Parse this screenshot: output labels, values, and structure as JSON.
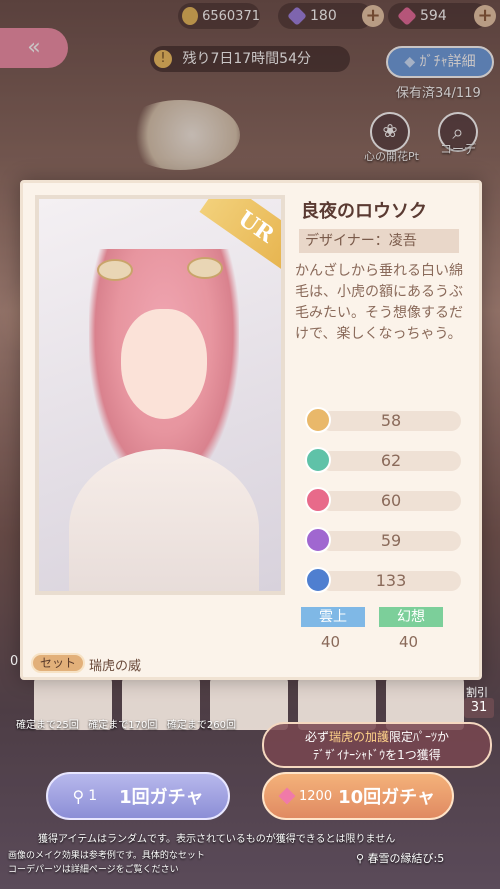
{
  "topbar": {
    "gold": "6560371",
    "purple_gem": "180",
    "pink_gem": "594"
  },
  "timer": "残り7日17時間54分",
  "gacha_detail_button": "ｶﾞﾁｬ詳細",
  "owned": "保有済34/119",
  "side_buttons": {
    "heart_flower": "心の開花Pt",
    "coord": "コーデ"
  },
  "card": {
    "rarity": "UR",
    "title": "良夜のロウソク",
    "designer": "デザイナー：凌吾",
    "description": "かんざしから垂れる白い綿毛は、小虎の額にあるうぶ毛みたい。そう想像するだけで、楽しくなっちゃう。",
    "stats": [
      {
        "value": "58",
        "color": "#e9b86a"
      },
      {
        "value": "62",
        "color": "#5fc2a8"
      },
      {
        "value": "60",
        "color": "#e86a8a"
      },
      {
        "value": "59",
        "color": "#a067d0"
      },
      {
        "value": "133",
        "color": "#4f7fd0"
      }
    ],
    "tags": [
      {
        "label": "雲上",
        "value": "40",
        "color": "#7fb8e6"
      },
      {
        "label": "幻想",
        "value": "40",
        "color": "#7ccf9a"
      }
    ]
  },
  "set": {
    "badge": "セット",
    "name": "瑞虎の威"
  },
  "guarantees": {
    "g1": "確定まで25回",
    "g2": "確定まで170回",
    "g3": "確定まで260回"
  },
  "discount": {
    "label": "割引",
    "value": "31"
  },
  "bonus_bubble": {
    "prefix": "必ず",
    "highlight": "瑞虎の加護",
    "rest1": "限定ﾊﾟｰﾂか",
    "line2": "ﾃﾞｻﾞｲﾅｰｼｬﾄﾞｳを1つ獲得"
  },
  "pull1": {
    "cost": "1",
    "label": "1回ガチャ"
  },
  "pull10": {
    "cost": "1200",
    "label": "10回ガチャ"
  },
  "disclaimer1": "獲得アイテムはランダムです。表示されているものが獲得できるとは限りません",
  "disclaimer2": "画像のメイク効果は参考例です。具体的なセット",
  "disclaimer3": "コーデパーツは詳細ページをご覧ください",
  "item_count": "春雪の縁結び:5",
  "side_badge": "0"
}
